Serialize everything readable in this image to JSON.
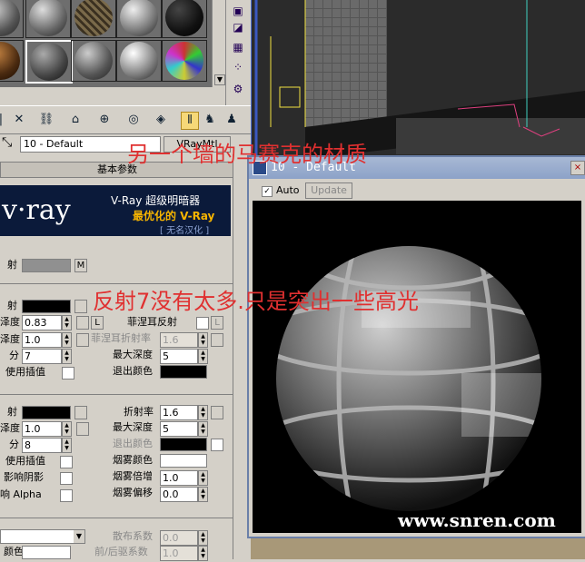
{
  "toolbar": {
    "material_name": "10 - Default",
    "material_type": "VRayMtl"
  },
  "rollout": {
    "title": "基本参数",
    "vray_banner": {
      "logo": "v·ray",
      "line1": "V-Ray 超级明暗器",
      "line2": "最优化的 V-Ray",
      "line3": "[ 无名汉化 ]"
    },
    "diffuse": {
      "label": "射",
      "map_button": "M"
    },
    "reflection": {
      "label": "射",
      "gloss_label": "泽度",
      "gloss_value": "0.83",
      "L_button": "L",
      "fresnel_label": "菲涅耳反射",
      "fresnel_ior_label": "菲涅耳折射率",
      "fresnel_ior_value": "1.6",
      "subdiv_gloss_label": "泽度",
      "subdiv_gloss_value": "1.0",
      "subdivs_label": "分",
      "subdivs_value": "7",
      "max_depth_label": "最大深度",
      "max_depth_value": "5",
      "interp_label": "使用插值",
      "exit_color_label": "退出颜色"
    },
    "refraction": {
      "label": "射",
      "ior_label": "折射率",
      "ior_value": "1.6",
      "gloss_label": "泽度",
      "gloss_value": "1.0",
      "max_depth_label": "最大深度",
      "max_depth_value": "5",
      "subdivs_label": "分",
      "subdivs_value": "8",
      "exit_color_label": "退出颜色",
      "interp_label": "使用插值",
      "fog_color_label": "烟雾颜色",
      "shadows_label": "影响阴影",
      "fog_mult_label": "烟雾倍增",
      "fog_mult_value": "1.0",
      "alpha_label": "响 Alpha",
      "fog_bias_label": "烟雾偏移",
      "fog_bias_value": "0.0"
    },
    "translucency": {
      "scatter_label": "散布系数",
      "scatter_value": "0.0",
      "color_label": "颜色",
      "fb_label": "前/后驱系数",
      "fb_value": "1.0"
    }
  },
  "material_window": {
    "title": "10 - Default",
    "auto_label": "Auto",
    "update_label": "Update",
    "close": "×"
  },
  "annotations": {
    "top": "另一个墙的马赛克的材质",
    "middle": "反射7没有太多.只是突出一些高光"
  },
  "watermark": "www.snren.com",
  "colors": {
    "annotation": "#e03030",
    "highlight_button": "#f6d878"
  }
}
